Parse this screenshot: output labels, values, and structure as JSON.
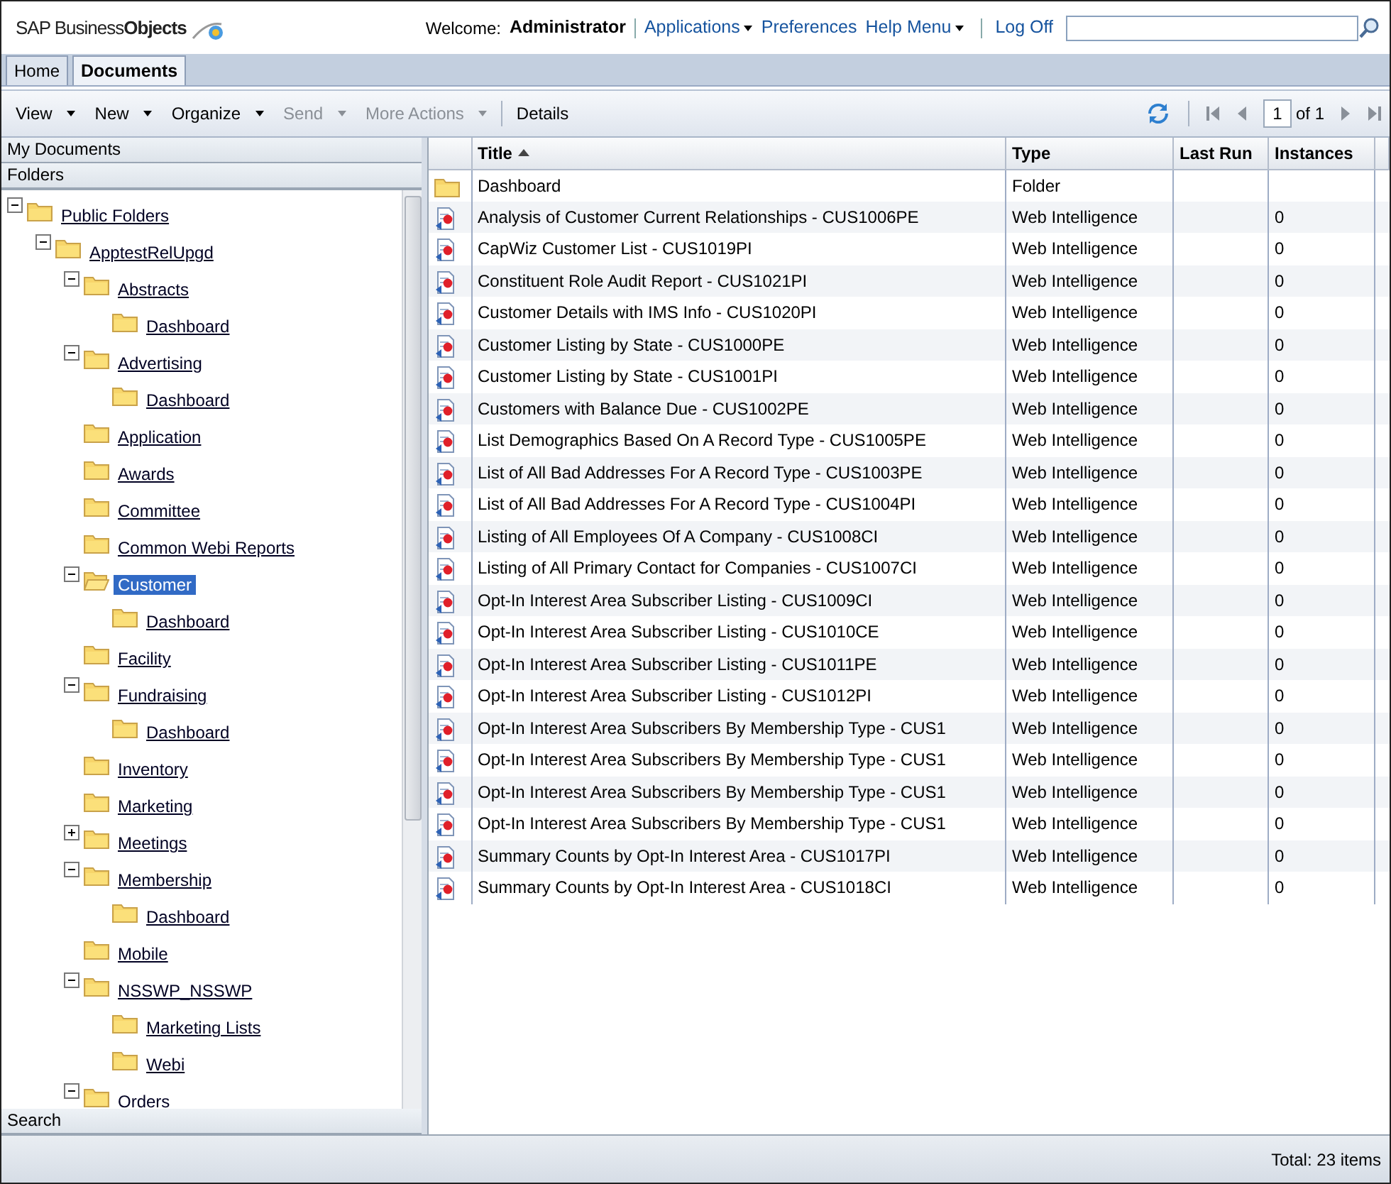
{
  "header": {
    "logo": "SAP Business**Objects**",
    "welcome_label": "Welcome:",
    "user": "Administrator",
    "links": [
      {
        "label": "Applications",
        "dropdown": true
      },
      {
        "label": "Preferences",
        "dropdown": false
      },
      {
        "label": "Help Menu",
        "dropdown": true
      },
      {
        "label": "Log Off",
        "dropdown": false
      }
    ]
  },
  "tabs": [
    {
      "label": "Home",
      "selected": false
    },
    {
      "label": "Documents",
      "selected": true
    }
  ],
  "toolbar": {
    "items": [
      {
        "label": "View",
        "dropdown": true,
        "disabled": false
      },
      {
        "label": "New",
        "dropdown": true,
        "disabled": false
      },
      {
        "label": "Organize",
        "dropdown": true,
        "disabled": false
      },
      {
        "label": "Send",
        "dropdown": true,
        "disabled": true
      },
      {
        "label": "More Actions",
        "dropdown": true,
        "disabled": true
      },
      {
        "label": "Details",
        "dropdown": false,
        "disabled": false
      }
    ],
    "page": "1",
    "page_total": "of 1"
  },
  "sidebar": {
    "sections": [
      "My Documents",
      "Folders"
    ],
    "tree": [
      {
        "label": "Public Folders",
        "expanded": true,
        "selected": false,
        "children": [
          {
            "label": "ApptestRelUpgd",
            "expanded": true,
            "selected": false,
            "children": [
              {
                "label": "Abstracts",
                "expanded": true,
                "selected": false,
                "children": [
                  {
                    "label": "Dashboard",
                    "selected": false
                  }
                ]
              },
              {
                "label": "Advertising",
                "expanded": true,
                "selected": false,
                "children": [
                  {
                    "label": "Dashboard",
                    "selected": false
                  }
                ]
              },
              {
                "label": "Application",
                "selected": false
              },
              {
                "label": "Awards",
                "selected": false
              },
              {
                "label": "Committee",
                "selected": false
              },
              {
                "label": "Common Webi Reports",
                "selected": false
              },
              {
                "label": "Customer",
                "expanded": true,
                "selected": true,
                "children": [
                  {
                    "label": "Dashboard",
                    "selected": false
                  }
                ]
              },
              {
                "label": "Facility",
                "selected": false
              },
              {
                "label": "Fundraising",
                "expanded": true,
                "selected": false,
                "children": [
                  {
                    "label": "Dashboard",
                    "selected": false
                  }
                ]
              },
              {
                "label": "Inventory",
                "selected": false
              },
              {
                "label": "Marketing",
                "selected": false
              },
              {
                "label": "Meetings",
                "expanded": false,
                "selected": false
              },
              {
                "label": "Membership",
                "expanded": true,
                "selected": false,
                "children": [
                  {
                    "label": "Dashboard",
                    "selected": false
                  }
                ]
              },
              {
                "label": "Mobile",
                "selected": false
              },
              {
                "label": "NSSWP_NSSWP",
                "expanded": true,
                "selected": false,
                "children": [
                  {
                    "label": "Marketing Lists",
                    "selected": false
                  },
                  {
                    "label": "Webi",
                    "selected": false
                  }
                ]
              },
              {
                "label": "Orders",
                "expanded": true,
                "selected": false
              }
            ]
          }
        ]
      }
    ],
    "search_section": "Search"
  },
  "table": {
    "columns": [
      {
        "label": "Title",
        "sorted": true
      },
      {
        "label": "Type",
        "sorted": false
      },
      {
        "label": "Last Run",
        "sorted": false
      },
      {
        "label": "Instances",
        "sorted": false
      }
    ],
    "rows": [
      {
        "kind": "folder",
        "title": "Dashboard",
        "type": "Folder"
      },
      {
        "kind": "report",
        "title": "Analysis of Customer Current Relationships - CUS1006PE",
        "type": "Web Intelligence",
        "instances": "0"
      },
      {
        "kind": "report",
        "title": "CapWiz Customer List - CUS1019PI",
        "type": "Web Intelligence",
        "instances": "0"
      },
      {
        "kind": "report",
        "title": "Constituent Role Audit Report - CUS1021PI",
        "type": "Web Intelligence",
        "instances": "0"
      },
      {
        "kind": "report",
        "title": "Customer Details with IMS Info - CUS1020PI",
        "type": "Web Intelligence",
        "instances": "0"
      },
      {
        "kind": "report",
        "title": "Customer Listing by State - CUS1000PE",
        "type": "Web Intelligence",
        "instances": "0"
      },
      {
        "kind": "report",
        "title": "Customer Listing by State - CUS1001PI",
        "type": "Web Intelligence",
        "instances": "0"
      },
      {
        "kind": "report",
        "title": "Customers with Balance Due - CUS1002PE",
        "type": "Web Intelligence",
        "instances": "0"
      },
      {
        "kind": "report",
        "title": "List Demographics Based On A Record Type - CUS1005PE",
        "type": "Web Intelligence",
        "instances": "0"
      },
      {
        "kind": "report",
        "title": "List of All Bad Addresses For A Record Type - CUS1003PE",
        "type": "Web Intelligence",
        "instances": "0"
      },
      {
        "kind": "report",
        "title": "List of All Bad Addresses For A Record Type - CUS1004PI",
        "type": "Web Intelligence",
        "instances": "0"
      },
      {
        "kind": "report",
        "title": "Listing of All Employees Of A Company - CUS1008CI",
        "type": "Web Intelligence",
        "instances": "0"
      },
      {
        "kind": "report",
        "title": "Listing of All Primary Contact for Companies - CUS1007CI",
        "type": "Web Intelligence",
        "instances": "0"
      },
      {
        "kind": "report",
        "title": "Opt-In Interest Area Subscriber Listing - CUS1009CI",
        "type": "Web Intelligence",
        "instances": "0"
      },
      {
        "kind": "report",
        "title": "Opt-In Interest Area Subscriber Listing - CUS1010CE",
        "type": "Web Intelligence",
        "instances": "0"
      },
      {
        "kind": "report",
        "title": "Opt-In Interest Area Subscriber Listing - CUS1011PE",
        "type": "Web Intelligence",
        "instances": "0"
      },
      {
        "kind": "report",
        "title": "Opt-In Interest Area Subscriber Listing - CUS1012PI",
        "type": "Web Intelligence",
        "instances": "0"
      },
      {
        "kind": "report",
        "title": "Opt-In Interest Area Subscribers By Membership Type - CUS1",
        "type": "Web Intelligence",
        "instances": "0"
      },
      {
        "kind": "report",
        "title": "Opt-In Interest Area Subscribers By Membership Type - CUS1",
        "type": "Web Intelligence",
        "instances": "0"
      },
      {
        "kind": "report",
        "title": "Opt-In Interest Area Subscribers By Membership Type - CUS1",
        "type": "Web Intelligence",
        "instances": "0"
      },
      {
        "kind": "report",
        "title": "Opt-In Interest Area Subscribers By Membership Type - CUS1",
        "type": "Web Intelligence",
        "instances": "0"
      },
      {
        "kind": "report",
        "title": "Summary Counts by Opt-In Interest Area - CUS1017PI",
        "type": "Web Intelligence",
        "instances": "0"
      },
      {
        "kind": "report",
        "title": "Summary Counts by Opt-In Interest Area - CUS1018CI",
        "type": "Web Intelligence",
        "instances": "0"
      }
    ]
  },
  "status_bar": "Total: 23 items"
}
